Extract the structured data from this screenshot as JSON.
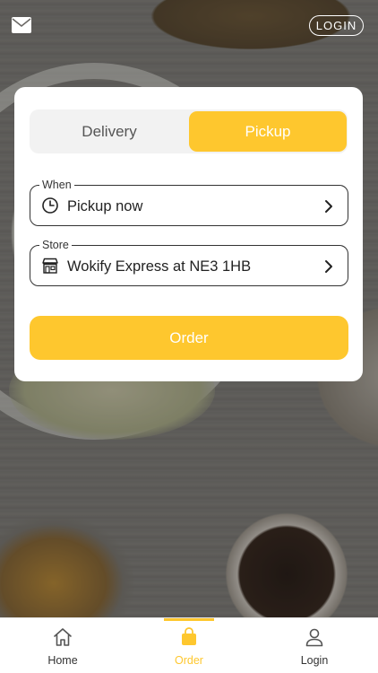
{
  "colors": {
    "accent": "#fec72e",
    "card_background": "#ffffff",
    "segment_background": "#f2f2f2",
    "inactive_text": "#555555"
  },
  "header": {
    "mail_icon": "envelope-icon",
    "login_label": "LOGIN"
  },
  "order_mode": {
    "options": [
      "Delivery",
      "Pickup"
    ],
    "selected": "Pickup"
  },
  "when_field": {
    "legend": "When",
    "value": "Pickup now",
    "icon": "clock-icon"
  },
  "store_field": {
    "legend": "Store",
    "value": "Wokify Express at NE3 1HB",
    "icon": "storefront-icon"
  },
  "order_button": {
    "label": "Order"
  },
  "bottom_nav": {
    "items": [
      {
        "label": "Home",
        "icon": "home-icon"
      },
      {
        "label": "Order",
        "icon": "shopping-bag-icon"
      },
      {
        "label": "Login",
        "icon": "user-icon"
      }
    ],
    "active": "Order"
  }
}
